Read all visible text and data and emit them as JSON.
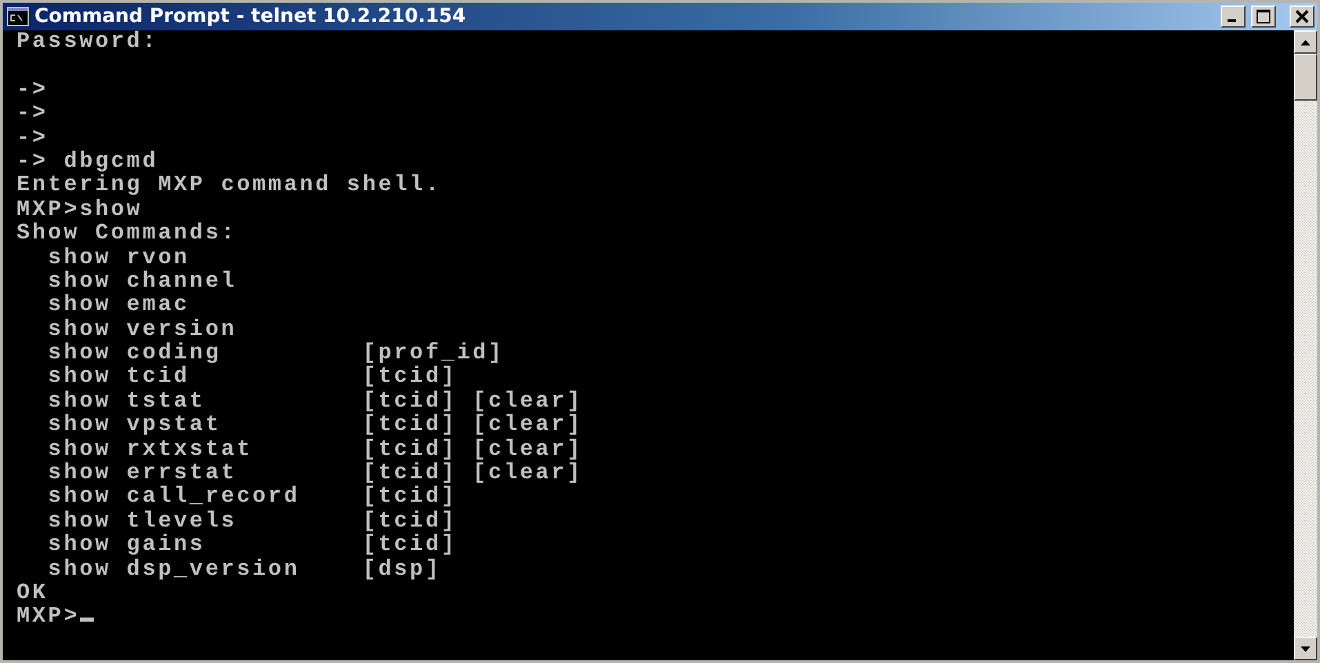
{
  "window": {
    "title": "Command Prompt - telnet 10.2.210.154"
  },
  "console": {
    "blocks": [
      [
        "Password:"
      ],
      [
        "->",
        "->",
        "->",
        "-> dbgcmd",
        "Entering MXP command shell.",
        "MXP>show",
        "Show Commands:",
        "  show rvon",
        "  show channel",
        "  show emac",
        "  show version",
        "  show coding         [prof_id]",
        "  show tcid           [tcid]",
        "  show tstat          [tcid] [clear]",
        "  show vpstat         [tcid] [clear]",
        "  show rxtxstat       [tcid] [clear]",
        "  show errstat        [tcid] [clear]",
        "  show call_record    [tcid]",
        "  show tlevels        [tcid]",
        "  show gains          [tcid]",
        "  show dsp_version    [dsp]",
        "OK"
      ]
    ],
    "prompt": "MXP>"
  }
}
